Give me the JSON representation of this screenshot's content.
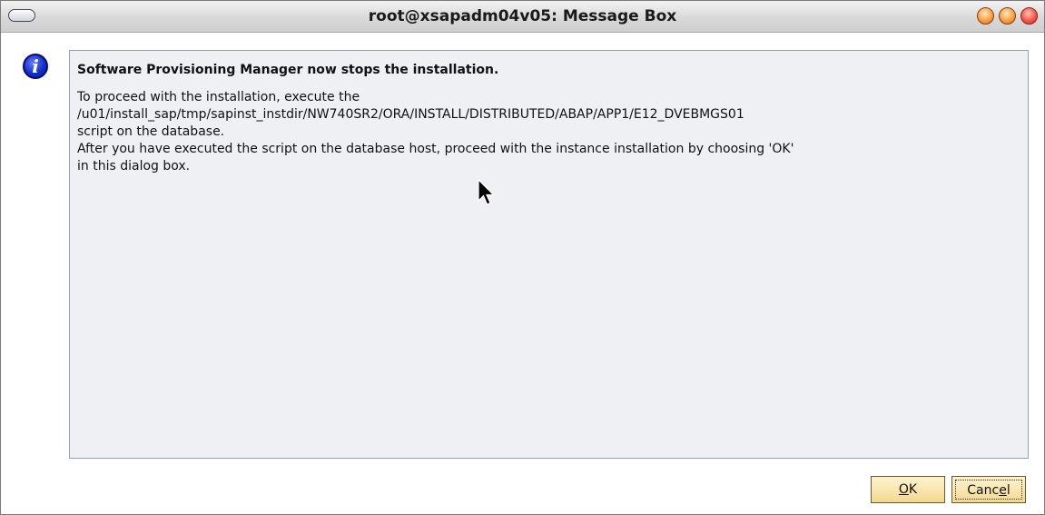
{
  "window": {
    "title": "root@xsapadm04v05: Message Box"
  },
  "icons": {
    "info": "i"
  },
  "message": {
    "heading": "Software Provisioning Manager now stops the installation.",
    "lines": [
      "To proceed with the installation, execute the",
      "/u01/install_sap/tmp/sapinst_instdir/NW740SR2/ORA/INSTALL/DISTRIBUTED/ABAP/APP1/E12_DVEBMGS01",
      "script on the database.",
      "After you have executed the script on the database host, proceed with the instance installation by choosing 'OK'",
      "in this dialog box."
    ]
  },
  "buttons": {
    "ok": {
      "mnemonic": "O",
      "rest": "K"
    },
    "cancel": {
      "pre": "Canc",
      "mnemonic": "e",
      "post": "l"
    }
  },
  "colors": {
    "button_fill": "#f3d88f",
    "message_bg": "#eef0f3",
    "close_button": "#f4584a",
    "min_max_button": "#f7a044"
  }
}
